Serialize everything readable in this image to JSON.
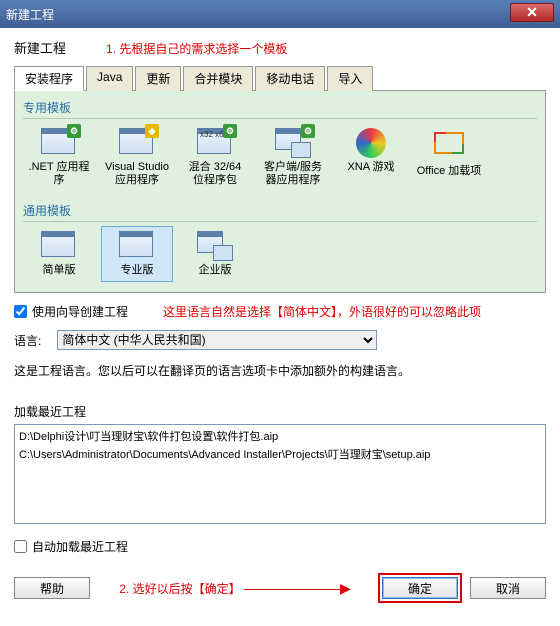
{
  "window": {
    "title": "新建工程",
    "close": "✕"
  },
  "annotations": {
    "step1": "1. 先根据自己的需求选择一个模板",
    "lang_hint": "这里语言自然是选择【简体中文】，外语很好的可以忽略此项",
    "step2": "2. 选好以后按【确定】"
  },
  "section_title": "新建工程",
  "tabs": [
    "安装程序",
    "Java",
    "更新",
    "合并模块",
    "移动电话",
    "导入"
  ],
  "groups": {
    "special": "专用模板",
    "general": "通用模板"
  },
  "templates": {
    "net": ".NET 应用程序",
    "vs": "Visual Studio 应用程序",
    "mix": "混合 32/64 位程序包",
    "mix_badge": "x32\nx64",
    "cs": "客户端/服务器应用程序",
    "xna": "XNA 游戏",
    "office": "Office 加载项",
    "simple": "简单版",
    "pro": "专业版",
    "ent": "企业版"
  },
  "wizard_check": "使用向导创建工程",
  "language": {
    "label": "语言:",
    "value": "简体中文 (中华人民共和国)"
  },
  "lang_desc": "这是工程语言。您以后可以在翻译页的语言选项卡中添加额外的构建语言。",
  "recent": {
    "label": "加载最近工程",
    "items": [
      "D:\\Delphi设计\\叮当理财宝\\软件打包设置\\软件打包.aip",
      "C:\\Users\\Administrator\\Documents\\Advanced Installer\\Projects\\叮当理财宝\\setup.aip"
    ],
    "auto": "自动加载最近工程"
  },
  "buttons": {
    "help": "帮助",
    "ok": "确定",
    "cancel": "取消"
  }
}
